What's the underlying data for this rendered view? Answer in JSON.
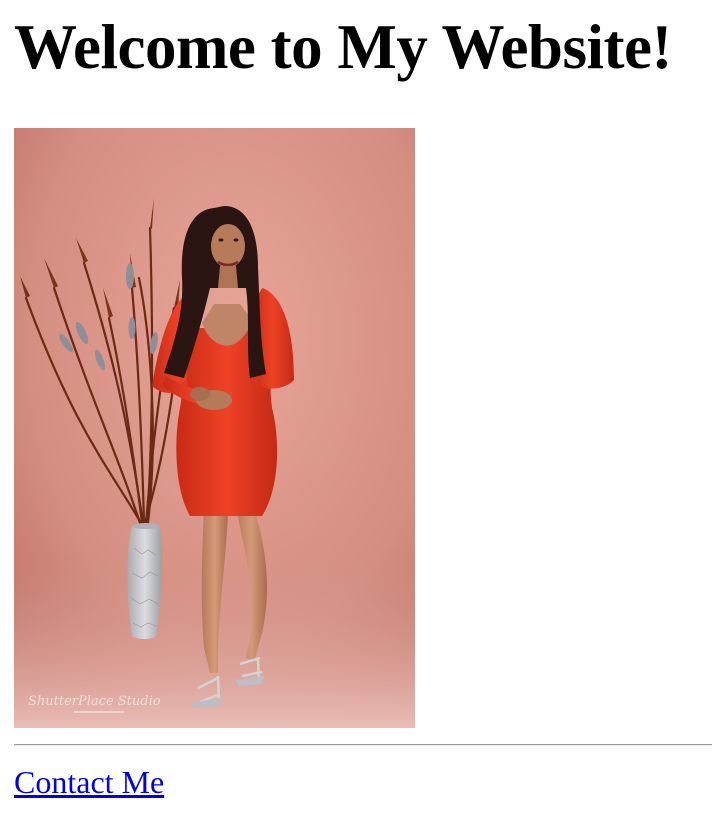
{
  "page": {
    "heading": "Welcome to My Website!",
    "link_text": "Contact Me"
  },
  "photo": {
    "subject": "woman in red dress posing beside vase with dried branches",
    "watermark": "ShutterPlace Studio",
    "colors": {
      "background": "#d9958a",
      "dress": "#e63a22",
      "vase": "#c7c7cc"
    }
  },
  "colors": {
    "link": "#0000ee",
    "text": "#000000",
    "rule": "#9a9a9a"
  }
}
